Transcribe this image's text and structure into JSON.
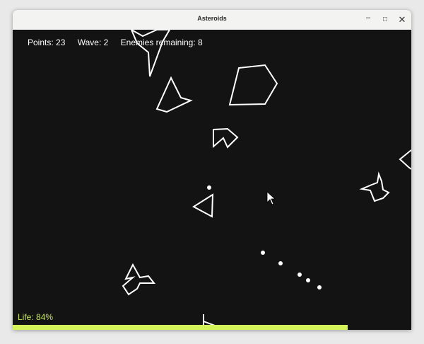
{
  "window": {
    "title": "Asteroids",
    "controls": {
      "minimize": "–",
      "maximize": "□",
      "close": "✕"
    }
  },
  "hud": {
    "points": "Points: 23",
    "wave": "Wave: 2",
    "enemies": "Enemies remaining: 8"
  },
  "life": {
    "label": "Life: 84%",
    "fraction": 0.84,
    "color": "#d4f25a",
    "label_color": "#c7e46a"
  },
  "colors": {
    "background": "#131313",
    "outline": "#ffffff"
  },
  "icons": {
    "cursor": "mouse-pointer-icon",
    "ship": "player-ship-icon"
  }
}
